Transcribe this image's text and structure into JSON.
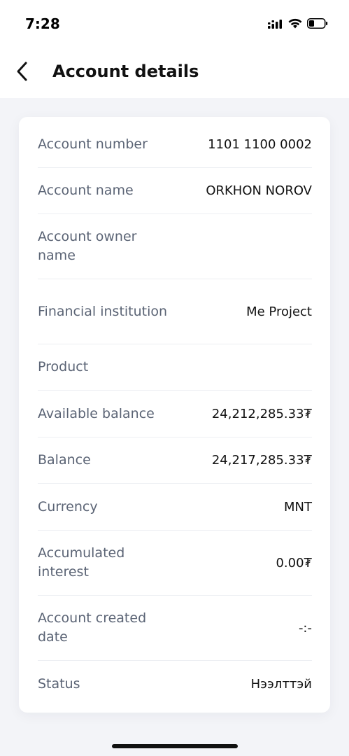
{
  "status_bar": {
    "time": "7:28"
  },
  "header": {
    "title": "Account details"
  },
  "details": [
    {
      "label": "Account number",
      "value": "1101 1100 0002"
    },
    {
      "label": "Account name",
      "value": "ORKHON NOROV"
    },
    {
      "label": "Account owner name",
      "value": ""
    },
    {
      "label": "Financial institution",
      "value": "Me Project"
    },
    {
      "label": "Product",
      "value": ""
    },
    {
      "label": "Available balance",
      "value": "24,212,285.33₮"
    },
    {
      "label": "Balance",
      "value": "24,217,285.33₮"
    },
    {
      "label": "Currency",
      "value": "MNT"
    },
    {
      "label": "Accumulated interest",
      "value": "0.00₮"
    },
    {
      "label": "Account created date",
      "value": "-:-"
    },
    {
      "label": "Status",
      "value": "Нээлттэй"
    }
  ],
  "icons": {
    "back": "chevron-left-icon",
    "signal": "cellular-signal-icon",
    "wifi": "wifi-icon",
    "battery": "battery-icon"
  }
}
